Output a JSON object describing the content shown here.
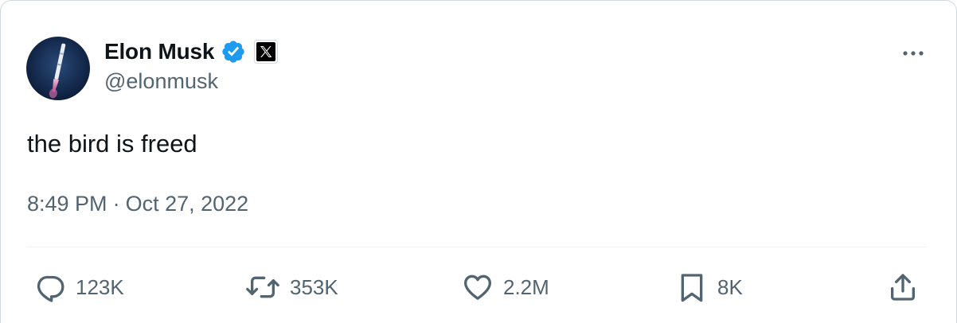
{
  "author": {
    "display_name": "Elon Musk",
    "handle": "@elonmusk",
    "verified_badge": "verified-icon",
    "affiliate_badge": "x-logo-icon",
    "badge_color": "#1d9bf0"
  },
  "tweet": {
    "text": "the bird is freed",
    "time": "8:49 PM",
    "separator": "·",
    "date": "Oct 27, 2022"
  },
  "actions": {
    "reply_count": "123K",
    "retweet_count": "353K",
    "like_count": "2.2M",
    "bookmark_count": "8K"
  },
  "icons": [
    "more-icon",
    "reply-icon",
    "retweet-icon",
    "like-icon",
    "bookmark-icon",
    "share-icon"
  ]
}
